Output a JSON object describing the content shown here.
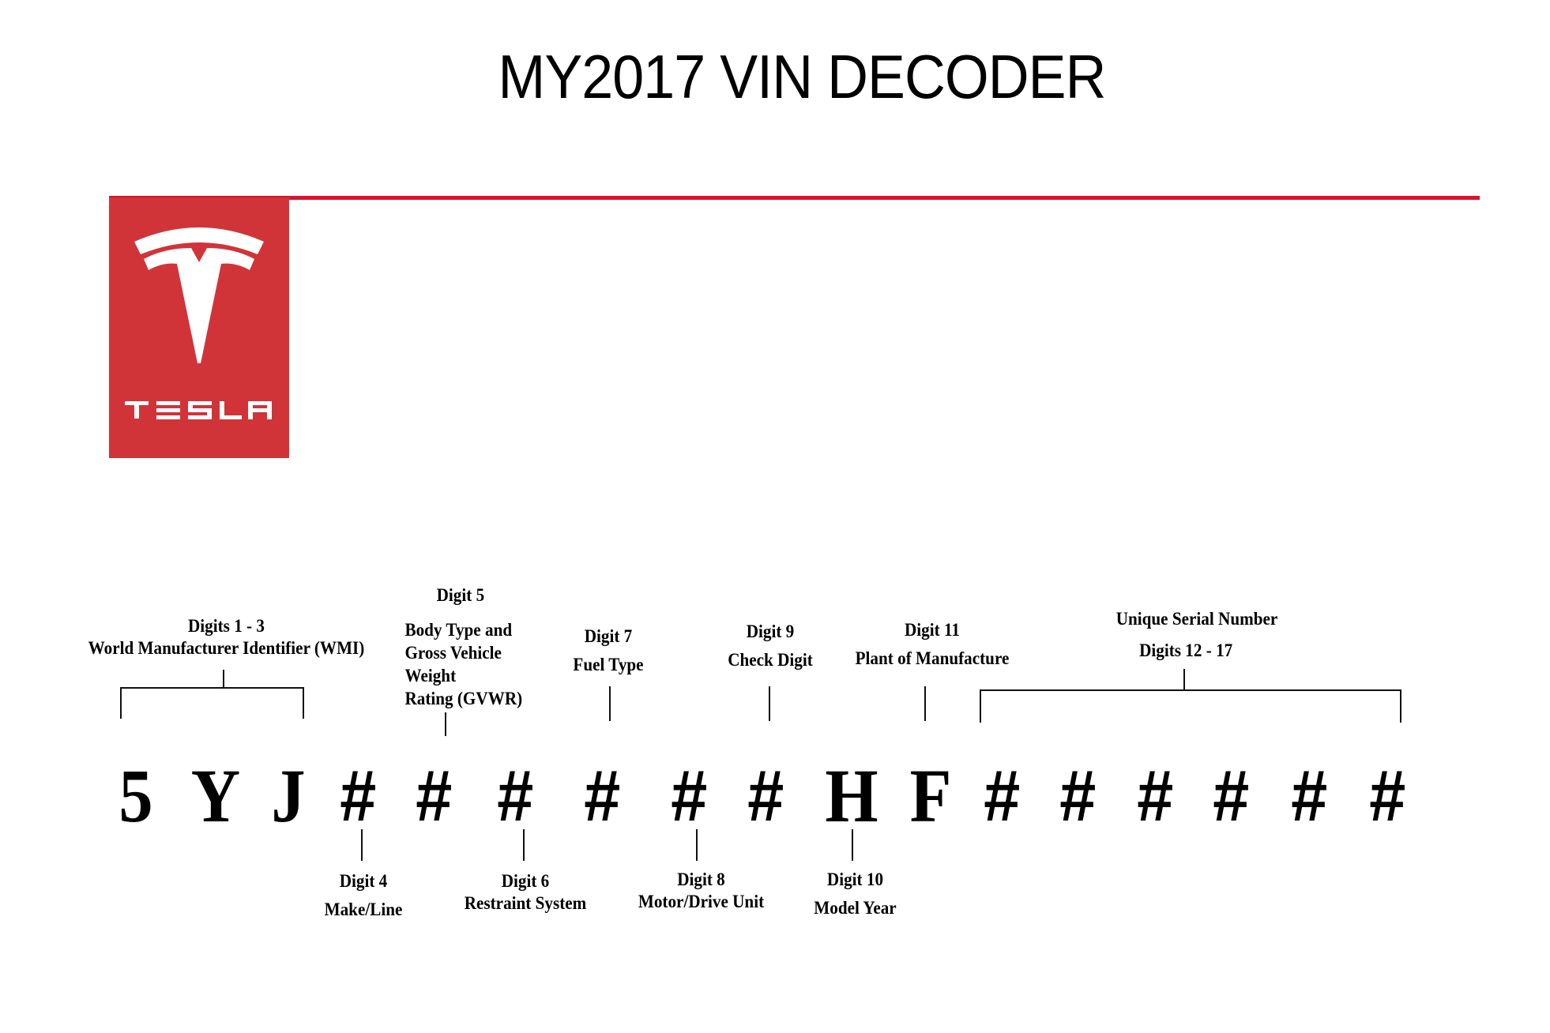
{
  "title": "MY2017 VIN DECODER",
  "brand": {
    "name": "TESLA",
    "logo_color": "#d13438",
    "rule_color": "#e0102e"
  },
  "vin_characters": [
    "5",
    "Y",
    "J",
    "#",
    "#",
    "#",
    "#",
    "#",
    "#",
    "H",
    "F",
    "#",
    "#",
    "#",
    "#",
    "#",
    "#"
  ],
  "labels": {
    "wmi": {
      "heading": "Digits 1 - 3",
      "desc": "World Manufacturer  Identifier  (WMI)"
    },
    "digit5": {
      "heading": "Digit 5",
      "desc": [
        "Body Type and",
        "Gross Vehicle",
        "Weight",
        "Rating (GVWR)"
      ]
    },
    "digit7": {
      "heading": "Digit 7",
      "desc": "Fuel Type"
    },
    "digit9": {
      "heading": "Digit 9",
      "desc": "Check Digit"
    },
    "digit11": {
      "heading": "Digit 11",
      "desc": "Plant of Manufacture"
    },
    "serial": {
      "heading": "Unique  Serial Number",
      "desc": "Digits 12 - 17"
    },
    "digit4": {
      "heading": "Digit 4",
      "desc": "Make/Line"
    },
    "digit6": {
      "heading": "Digit 6",
      "desc": "Restraint  System"
    },
    "digit8": {
      "heading": "Digit 8",
      "desc": "Motor/Drive Unit"
    },
    "digit10": {
      "heading": "Digit 10",
      "desc": "Model Year"
    }
  }
}
